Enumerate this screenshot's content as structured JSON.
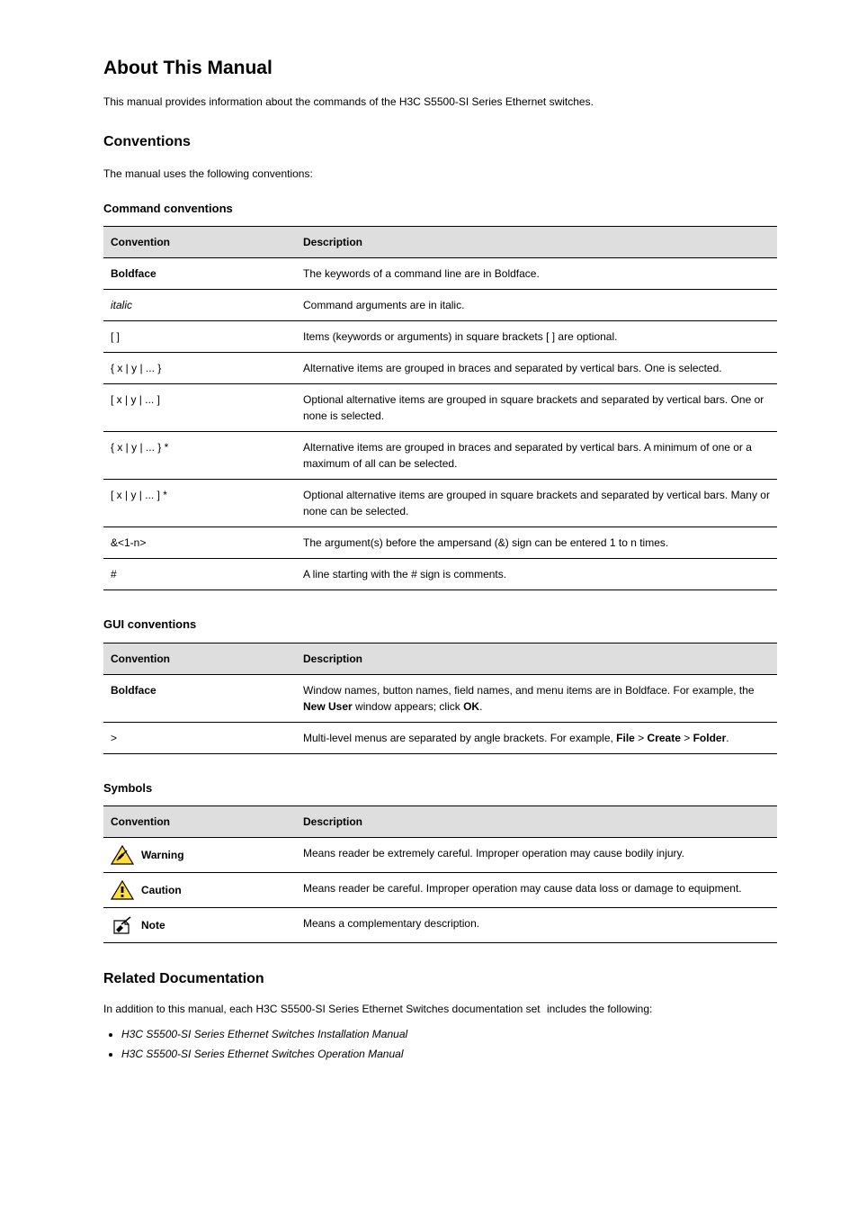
{
  "page_title": "About This Manual",
  "intro": "This manual provides information about the commands of the H3C S5500-SI Series Ethernet switches.",
  "conventions_heading": "Conventions",
  "conventions_lead": "The manual uses the following conventions:",
  "command_conv_heading": "Command conventions",
  "command_headers": {
    "col1": "Convention",
    "col2": "Description"
  },
  "command_rows": [
    {
      "conv": "Boldface",
      "klass": "boldface",
      "desc": "The keywords of a command line are in Boldface."
    },
    {
      "conv": "italic",
      "klass": "italicface",
      "desc": "Command arguments are in italic."
    },
    {
      "conv": "[ ]",
      "klass": "",
      "desc": "Items (keywords or arguments) in square brackets [ ] are optional."
    },
    {
      "conv": "{ x | y | ... }",
      "klass": "",
      "desc": "Alternative items are grouped in braces and separated by vertical bars. One is selected."
    },
    {
      "conv": "[ x | y | ... ]",
      "klass": "",
      "desc": "Optional alternative items are grouped in square brackets and separated by vertical bars. One or none is selected."
    },
    {
      "conv": "{ x | y | ... } *",
      "klass": "",
      "desc": "Alternative items are grouped in braces and separated by vertical bars. A minimum of one or a maximum of all can be selected."
    },
    {
      "conv": "[ x | y | ... ] *",
      "klass": "",
      "desc": "Optional alternative items are grouped in square brackets and separated by vertical bars. Many or none can be selected."
    },
    {
      "conv": "&<1-n>",
      "klass": "",
      "desc": "The argument(s) before the ampersand (&) sign can be entered 1 to n times."
    },
    {
      "conv": "#",
      "klass": "",
      "desc": "A line starting with the # sign is comments."
    }
  ],
  "gui_conv_heading": "GUI conventions",
  "gui_headers": {
    "col1": "Convention",
    "col2": "Description"
  },
  "gui_rows": [
    {
      "conv": "Boldface",
      "klass": "boldface",
      "desc_pre": "Window names, button names, field names, and menu items are in Boldface. For example, the ",
      "desc_bold": "New User",
      "desc_post": " window appears; click ",
      "desc_bold2": "OK",
      "desc_end": "."
    },
    {
      "conv": ">",
      "klass": "",
      "desc_pre": "Multi-level menus are separated by angle brackets. For example, ",
      "desc_bold": "File",
      "desc_mid1": " > ",
      "desc_bold2": "Create",
      "desc_mid2": " > ",
      "desc_bold3": "Folder",
      "desc_end": "."
    }
  ],
  "symbols_heading": "Symbols",
  "symbols_headers": {
    "col1": "Convention",
    "col2": "Description"
  },
  "symbols_rows": [
    {
      "icon": "warning",
      "label": "Warning",
      "desc": "Means reader be extremely careful. Improper operation may cause bodily injury."
    },
    {
      "icon": "caution",
      "label": "Caution",
      "desc": "Means reader be careful. Improper operation may cause data loss or damage to equipment."
    },
    {
      "icon": "note",
      "label": "Note",
      "desc": "Means a complementary description."
    }
  ],
  "related_heading": "Related Documentation",
  "related_lead_pre": "In addition to this manual, each H3C S5500-SI Series Ethernet Switches documentation set",
  "related_lead_post": "includes the following:",
  "related_items": [
    "H3C S5500-SI Series Ethernet Switches Installation Manual",
    "H3C S5500-SI Series Ethernet Switches Operation Manual"
  ]
}
